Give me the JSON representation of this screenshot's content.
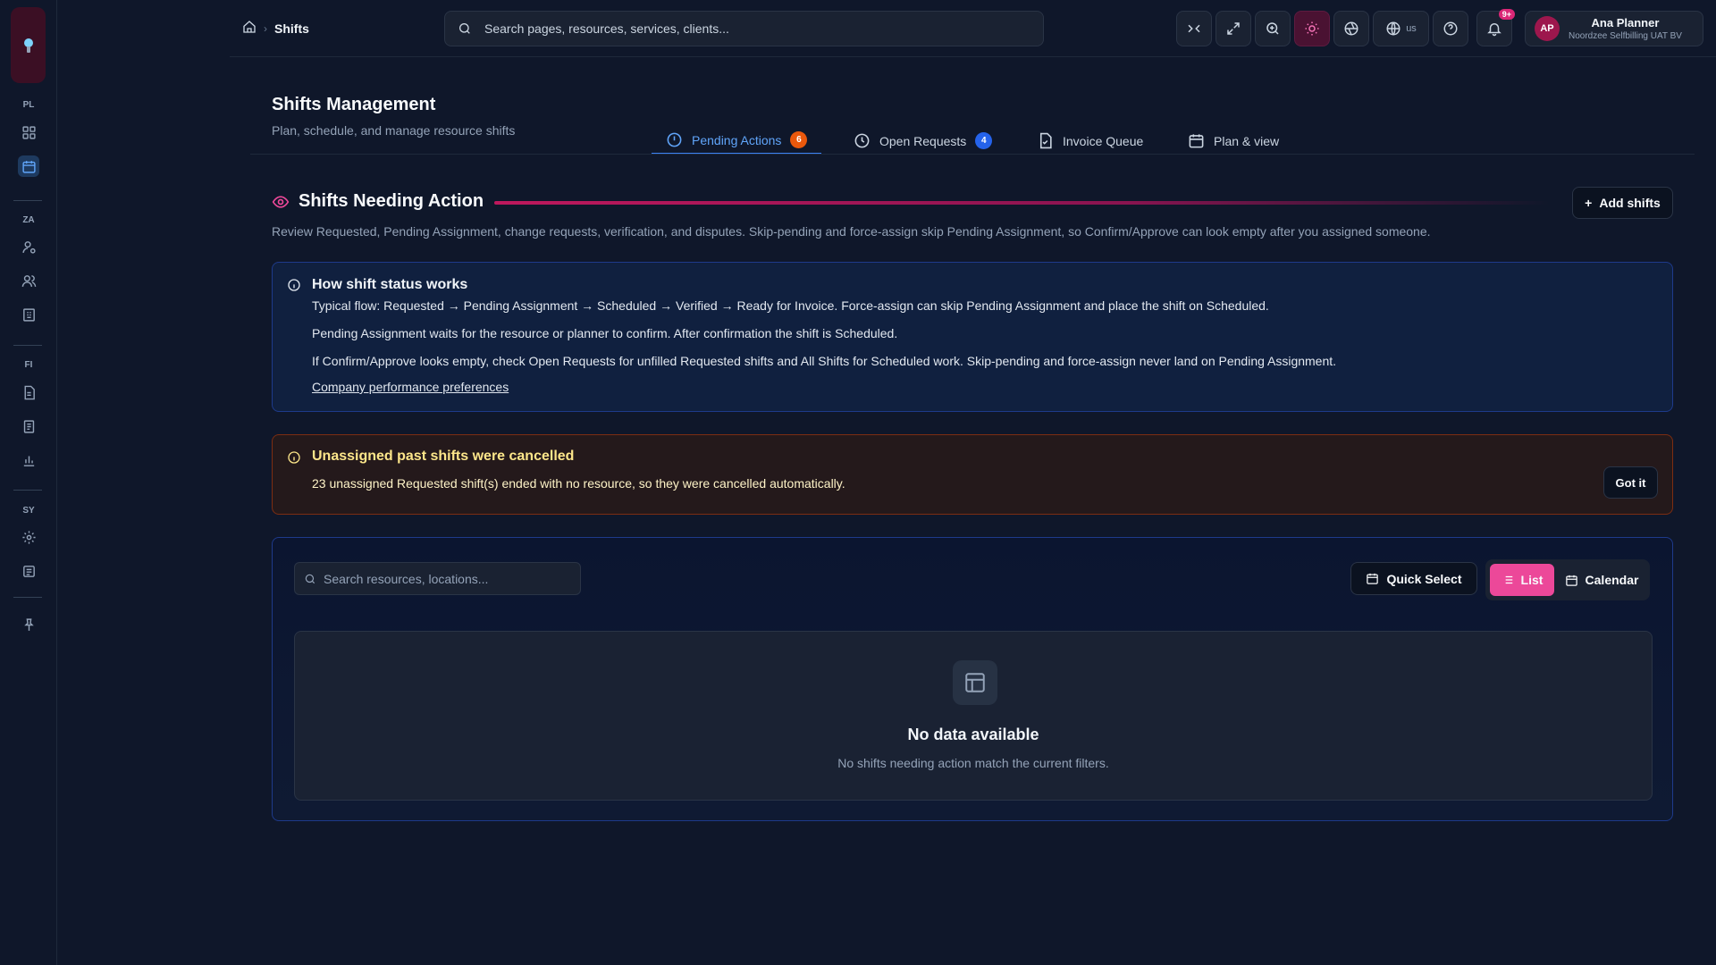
{
  "rail": {
    "sections": [
      "PL",
      "ZA",
      "FI",
      "SY"
    ]
  },
  "topbar": {
    "breadcrumb_current": "Shifts",
    "search_placeholder": "Search pages, resources, services, clients...",
    "language": "us",
    "notifications_badge": "9+",
    "user": {
      "initials": "AP",
      "name": "Ana Planner",
      "org": "Noordzee Selfbilling UAT BV"
    }
  },
  "page": {
    "title": "Shifts Management",
    "subtitle": "Plan, schedule, and manage resource shifts"
  },
  "tabs": [
    {
      "label": "Pending Actions",
      "count": "6",
      "active": true
    },
    {
      "label": "Open Requests",
      "count": "4",
      "active": false
    },
    {
      "label": "Invoice Queue",
      "active": false
    },
    {
      "label": "Plan & view",
      "active": false
    }
  ],
  "section": {
    "title": "Shifts Needing Action",
    "add_label": "Add shifts",
    "description": "Review Requested, Pending Assignment, change requests, verification, and disputes. Skip-pending and force-assign skip Pending Assignment, so Confirm/Approve can look empty after you assigned someone."
  },
  "info": {
    "title": "How shift status works",
    "lines": [
      "Typical flow: Requested → Pending Assignment → Scheduled → Verified → Ready for Invoice. Force-assign can skip Pending Assignment and place the shift on Scheduled.",
      "Pending Assignment waits for the resource or planner to confirm. After confirmation the shift is Scheduled.",
      "If Confirm/Approve looks empty, check Open Requests for unfilled Requested shifts and All Shifts for Scheduled work. Skip-pending and force-assign never land on Pending Assignment."
    ],
    "link": "Company performance preferences"
  },
  "warning": {
    "title": "Unassigned past shifts were cancelled",
    "text": "23 unassigned Requested shift(s) ended with no resource, so they were cancelled automatically.",
    "button": "Got it"
  },
  "panel": {
    "search_placeholder": "Search resources, locations...",
    "quick_select": "Quick Select",
    "list_label": "List",
    "calendar_label": "Calendar",
    "empty_title": "No data available",
    "empty_sub": "No shifts needing action match the current filters."
  },
  "colors": {
    "accent_pink": "#ec4899",
    "tab_active": "#3b82f6",
    "pending_badge": "#ea580c",
    "requests_badge": "#2563eb"
  }
}
